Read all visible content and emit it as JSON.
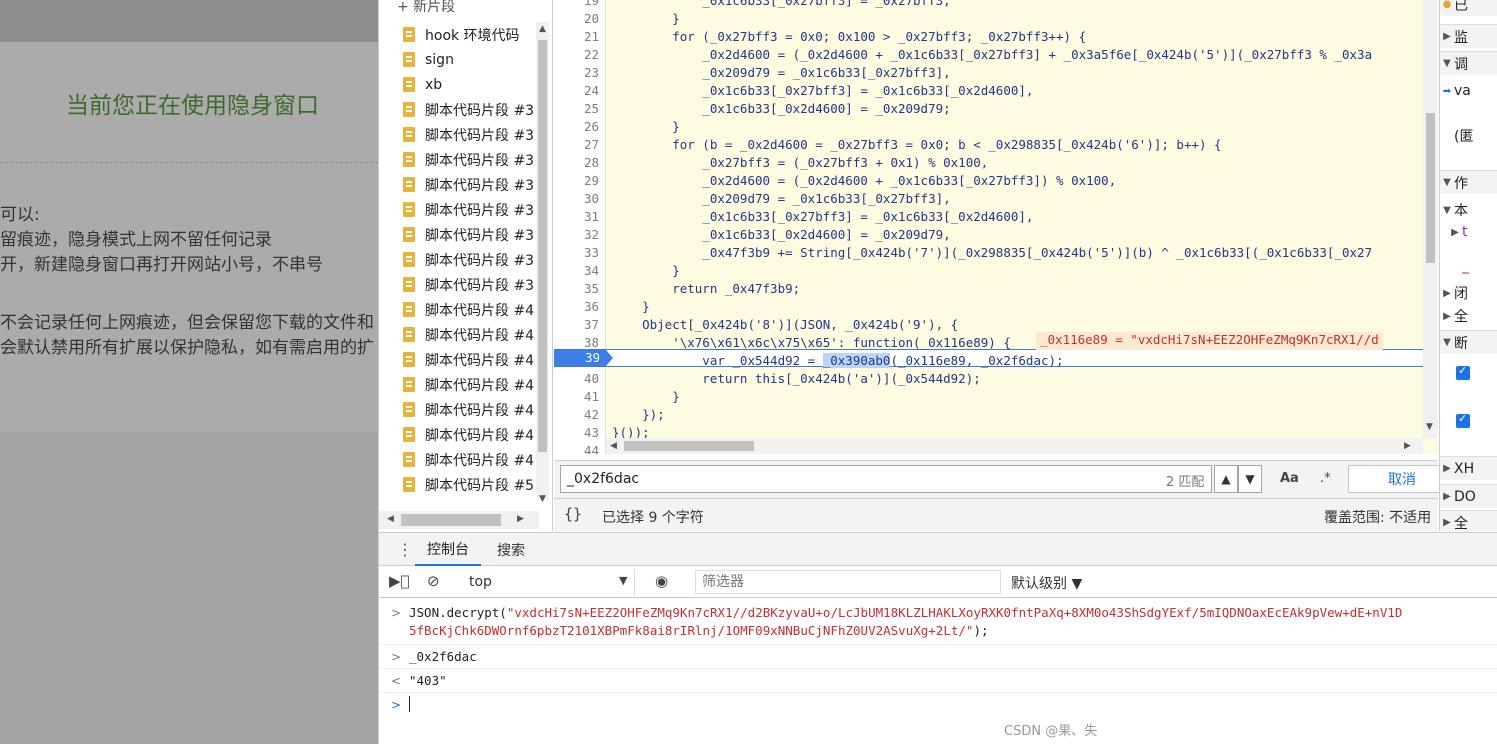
{
  "page": {
    "title": "当前您正在使用隐身窗口",
    "lines": [
      "可以:",
      "留痕迹，隐身模式上网不留任何记录",
      "开，新建隐身窗口再打开网站小号，不串号",
      "不会记录任何上网痕迹，但会保留您下载的文件和",
      "会默认禁用所有扩展以保护隐私，如有需启用的扩"
    ]
  },
  "navigator": {
    "header": "+ 新片段",
    "items": [
      "hook 环境代码",
      "sign",
      "xb",
      "脚本代码片段 #3",
      "脚本代码片段 #3",
      "脚本代码片段 #3",
      "脚本代码片段 #3",
      "脚本代码片段 #3",
      "脚本代码片段 #3",
      "脚本代码片段 #3",
      "脚本代码片段 #3",
      "脚本代码片段 #4",
      "脚本代码片段 #4",
      "脚本代码片段 #4",
      "脚本代码片段 #4",
      "脚本代码片段 #4",
      "脚本代码片段 #4",
      "脚本代码片段 #4",
      "脚本代码片段 #5"
    ]
  },
  "editor": {
    "breakpoint_line": "39",
    "inline_value": "_0x116e89 = \"vxdcHi7sN+EEZ2OHFeZMq9Kn7cRX1//d",
    "lines": [
      {
        "n": "19",
        "t": "            _0x1c6b33[_0x27bff3] = _0x27bff3;"
      },
      {
        "n": "20",
        "t": "        }"
      },
      {
        "n": "21",
        "t": "        for (_0x27bff3 = 0x0; 0x100 > _0x27bff3; _0x27bff3++) {"
      },
      {
        "n": "22",
        "t": "            _0x2d4600 = (_0x2d4600 + _0x1c6b33[_0x27bff3] + _0x3a5f6e[_0x424b('5')](_0x27bff3 % _0x3a"
      },
      {
        "n": "23",
        "t": "            _0x209d79 = _0x1c6b33[_0x27bff3],"
      },
      {
        "n": "24",
        "t": "            _0x1c6b33[_0x27bff3] = _0x1c6b33[_0x2d4600],"
      },
      {
        "n": "25",
        "t": "            _0x1c6b33[_0x2d4600] = _0x209d79;"
      },
      {
        "n": "26",
        "t": "        }"
      },
      {
        "n": "27",
        "t": "        for (b = _0x2d4600 = _0x27bff3 = 0x0; b < _0x298835[_0x424b('6')]; b++) {"
      },
      {
        "n": "28",
        "t": "            _0x27bff3 = (_0x27bff3 + 0x1) % 0x100,"
      },
      {
        "n": "29",
        "t": "            _0x2d4600 = (_0x2d4600 + _0x1c6b33[_0x27bff3]) % 0x100,"
      },
      {
        "n": "30",
        "t": "            _0x209d79 = _0x1c6b33[_0x27bff3],"
      },
      {
        "n": "31",
        "t": "            _0x1c6b33[_0x27bff3] = _0x1c6b33[_0x2d4600],"
      },
      {
        "n": "32",
        "t": "            _0x1c6b33[_0x2d4600] = _0x209d79,"
      },
      {
        "n": "33",
        "t": "            _0x47f3b9 += String[_0x424b('7')](_0x298835[_0x424b('5')](b) ^ _0x1c6b33[(_0x1c6b33[_0x27"
      },
      {
        "n": "34",
        "t": "        }"
      },
      {
        "n": "35",
        "t": "        return _0x47f3b9;"
      },
      {
        "n": "36",
        "t": "    }"
      },
      {
        "n": "37",
        "t": "    Object[_0x424b('8')](JSON, _0x424b('9'), {"
      },
      {
        "n": "38",
        "t": "        '\\x76\\x61\\x6c\\x75\\x65': function(_0x116e89) {"
      },
      {
        "n": "39",
        "t": "            var _0x544d92 = _0x390ab0(_0x116e89, _0x2f6dac);"
      },
      {
        "n": "40",
        "t": "            return this[_0x424b('a')](_0x544d92);"
      },
      {
        "n": "41",
        "t": "        }"
      },
      {
        "n": "42",
        "t": "    });"
      },
      {
        "n": "43",
        "t": "}());"
      },
      {
        "n": "44",
        "t": ""
      }
    ]
  },
  "search": {
    "value": "_0x2f6dac",
    "count": "2 匹配",
    "prev": "▲",
    "next": "▼",
    "case": "Aa",
    "regex": ".*",
    "cancel": "取消"
  },
  "status": {
    "pretty": "{}",
    "selection": "已选择 9 个字符",
    "coverage": "覆盖范围: 不适用"
  },
  "right_pane": {
    "rows": [
      "已",
      "监",
      "调",
      "va",
      "(匿",
      "作",
      "本",
      "t",
      "_",
      "闭",
      "全",
      "断",
      "XH",
      "DO",
      "全"
    ]
  },
  "drawer": {
    "menu": "⋮",
    "tab_console": "控制台",
    "tab_search": "搜索"
  },
  "console_toolbar": {
    "context": "top",
    "filter_placeholder": "筛选器",
    "level": "默认级别 ▼"
  },
  "console": {
    "cmd1_fn": "JSON.decrypt(",
    "cmd1_arg1": "\"vxdcHi7sN+EEZ2OHFeZMq9Kn7cRX1//d2BKzyvaU+o/LcJbUM18KLZLHAKLXoyRXK0fntPaXq+8XM0o43ShSdgYExf/5mIQDNOaxEcEAk9pVew+dE+nV1D",
    "cmd1_arg2": "5fBcKjChk6DWOrnf6pbzT2101XBPmFk8ai8rIRlnj/1OMF09xNNBuCjNFhZ0UV2ASvuXg+2Lt/\"",
    "cmd1_end": ");",
    "cmd2": "_0x2f6dac",
    "result": "\"403\""
  },
  "watermark": "CSDN @果、失"
}
